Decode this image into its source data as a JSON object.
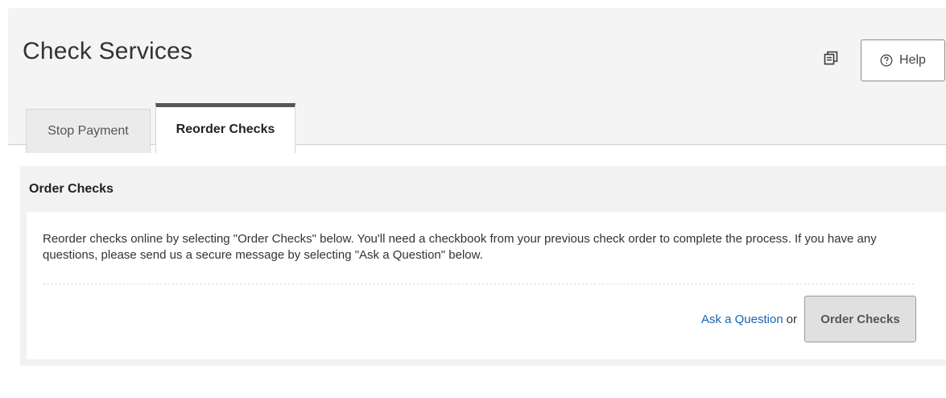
{
  "header": {
    "title": "Check Services",
    "help_label": "Help",
    "print_icon": "print-icon",
    "help_icon": "question-circle-icon"
  },
  "tabs": [
    {
      "label": "Stop Payment",
      "active": false
    },
    {
      "label": "Reorder Checks",
      "active": true
    }
  ],
  "panel": {
    "title": "Order Checks",
    "description": "Reorder checks online by selecting \"Order Checks\" below. You'll need a checkbook from your previous check order to complete the process. If you have any questions, please send us a secure message by selecting \"Ask a Question\" below.",
    "ask_link": "Ask a Question",
    "or_text": "or",
    "order_button": "Order Checks"
  },
  "colors": {
    "link": "#1a64b5",
    "active_tab_border": "#555555",
    "header_bg": "#f4f4f4"
  }
}
